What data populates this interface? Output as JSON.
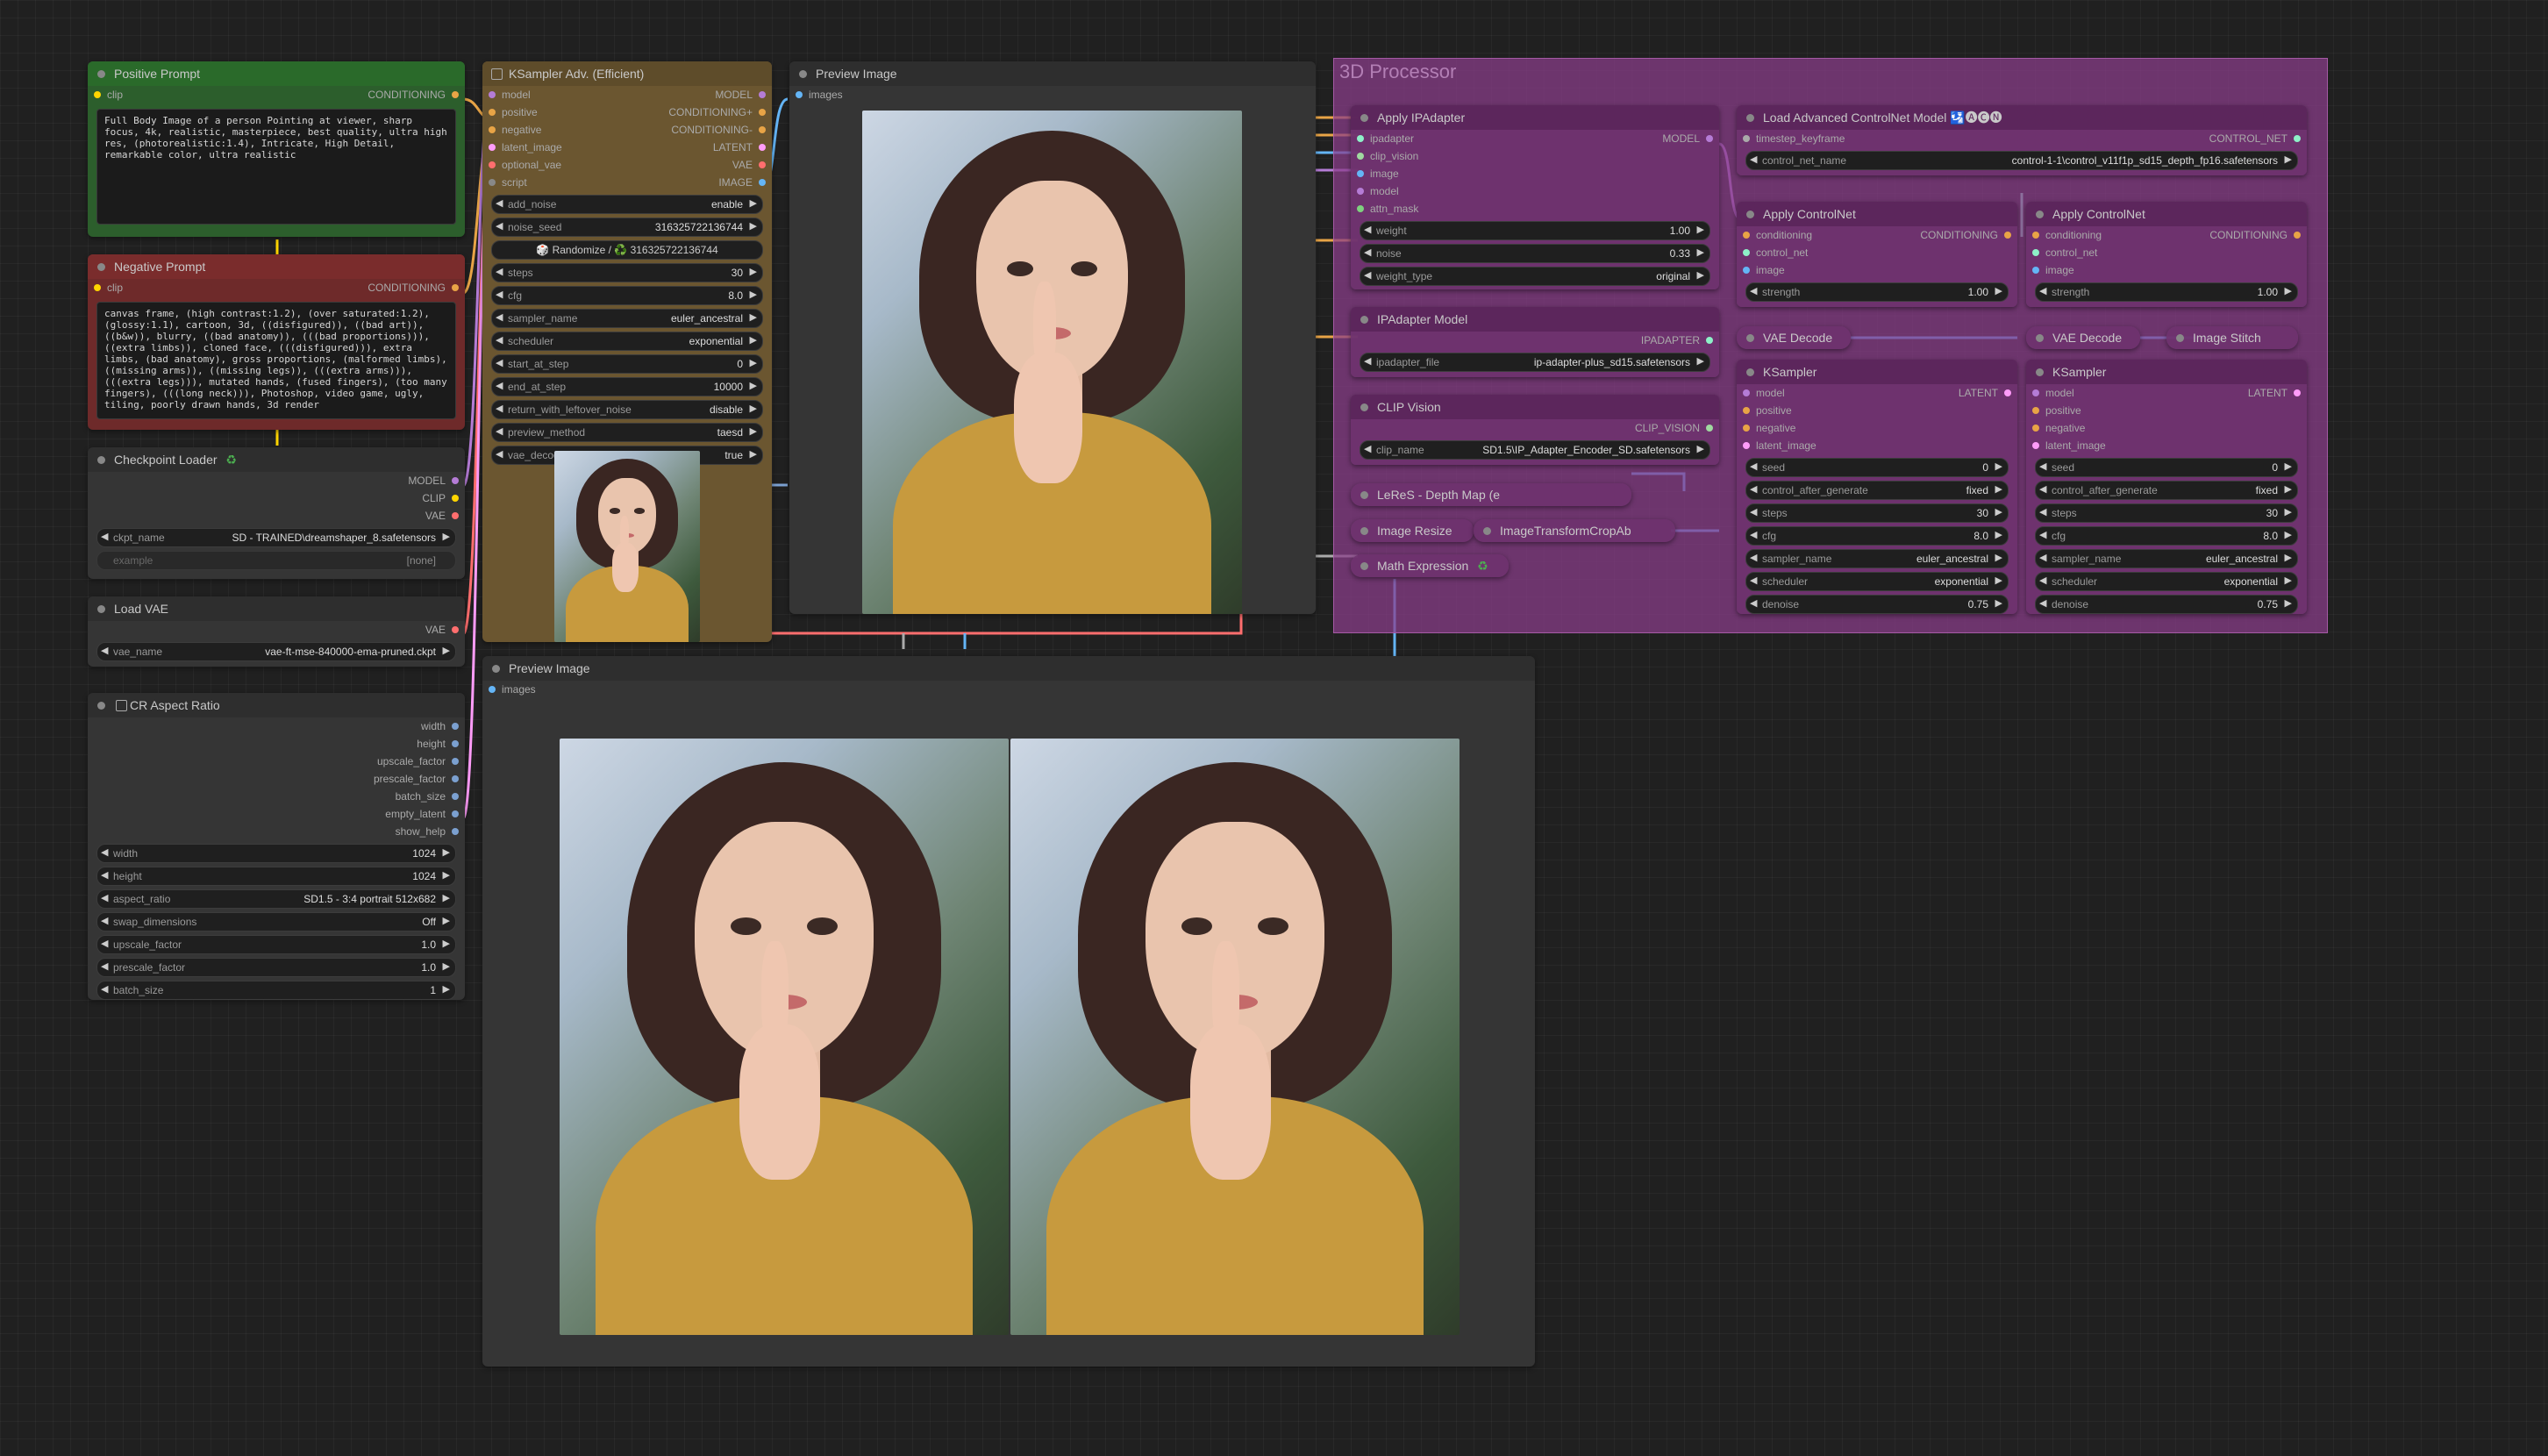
{
  "colors": {
    "group_3d_processor": "#8a3d8a",
    "positive_node": "#2c5e2c",
    "negative_node": "#6e2a2a",
    "ksampler_node": "#6b5630",
    "wire_model": "#b57cd6",
    "wire_conditioning": "#e8a446",
    "wire_latent": "#ff9cf9",
    "wire_image": "#64b5f6",
    "wire_vae": "#ff6e6e",
    "wire_clip": "#ffd500"
  },
  "positive_prompt": {
    "title": "Positive Prompt",
    "input_clip": "clip",
    "output": "CONDITIONING",
    "text": "Full Body Image of a person Pointing at viewer, sharp focus, 4k, realistic, masterpiece, best quality, ultra high res, (photorealistic:1.4), Intricate, High Detail, remarkable color, ultra realistic"
  },
  "negative_prompt": {
    "title": "Negative Prompt",
    "input_clip": "clip",
    "output": "CONDITIONING",
    "text": "canvas frame, (high contrast:1.2), (over saturated:1.2), (glossy:1.1), cartoon, 3d, ((disfigured)), ((bad art)), ((b&w)), blurry, ((bad anatomy)), (((bad proportions))), ((extra limbs)), cloned face, (((disfigured))), extra limbs, (bad anatomy), gross proportions, (malformed limbs), ((missing arms)), ((missing legs)), (((extra arms))), (((extra legs))), mutated hands, (fused fingers), (too many fingers), (((long neck))), Photoshop, video game, ugly, tiling, poorly drawn hands, 3d render"
  },
  "checkpoint_loader": {
    "title": "Checkpoint Loader",
    "outputs": [
      "MODEL",
      "CLIP",
      "VAE"
    ],
    "ckpt_label": "ckpt_name",
    "ckpt_value": "SD - TRAINED\\dreamshaper_8.safetensors",
    "example_label": "example",
    "example_value": "[none]"
  },
  "load_vae": {
    "title": "Load VAE",
    "output": "VAE",
    "vae_label": "vae_name",
    "vae_value": "vae-ft-mse-840000-ema-pruned.ckpt"
  },
  "cr_aspect_ratio": {
    "title": "CR Aspect Ratio",
    "outputs": [
      "width",
      "height",
      "upscale_factor",
      "prescale_factor",
      "batch_size",
      "empty_latent",
      "show_help"
    ],
    "widgets": [
      {
        "label": "width",
        "value": "1024"
      },
      {
        "label": "height",
        "value": "1024"
      },
      {
        "label": "aspect_ratio",
        "value": "SD1.5 - 3:4 portrait 512x682"
      },
      {
        "label": "swap_dimensions",
        "value": "Off"
      },
      {
        "label": "upscale_factor",
        "value": "1.0"
      },
      {
        "label": "prescale_factor",
        "value": "1.0"
      },
      {
        "label": "batch_size",
        "value": "1"
      }
    ]
  },
  "ksampler_adv": {
    "title": "KSampler Adv. (Efficient)",
    "inputs": [
      "model",
      "positive",
      "negative",
      "latent_image",
      "optional_vae",
      "script"
    ],
    "outputs": [
      "MODEL",
      "CONDITIONING+",
      "CONDITIONING-",
      "LATENT",
      "VAE",
      "IMAGE"
    ],
    "widgets": [
      {
        "label": "add_noise",
        "value": "enable"
      },
      {
        "label": "noise_seed",
        "value": "316325722136744"
      },
      {
        "label": "steps",
        "value": "30"
      },
      {
        "label": "cfg",
        "value": "8.0"
      },
      {
        "label": "sampler_name",
        "value": "euler_ancestral"
      },
      {
        "label": "scheduler",
        "value": "exponential"
      },
      {
        "label": "start_at_step",
        "value": "0"
      },
      {
        "label": "end_at_step",
        "value": "10000"
      },
      {
        "label": "return_with_leftover_noise",
        "value": "disable"
      },
      {
        "label": "preview_method",
        "value": "taesd"
      },
      {
        "label": "vae_decode",
        "value": "true"
      }
    ],
    "randomize_button": "🎲 Randomize / ♻️ 316325722136744"
  },
  "preview_image_top": {
    "title": "Preview Image",
    "input": "images"
  },
  "preview_image_bottom": {
    "title": "Preview Image",
    "input": "images"
  },
  "group_3d": {
    "title": "3D Processor",
    "apply_ipadapter": {
      "title": "Apply IPAdapter",
      "inputs": [
        "ipadapter",
        "clip_vision",
        "image",
        "model",
        "attn_mask"
      ],
      "output": "MODEL",
      "widgets": [
        {
          "label": "weight",
          "value": "1.00"
        },
        {
          "label": "noise",
          "value": "0.33"
        },
        {
          "label": "weight_type",
          "value": "original"
        }
      ]
    },
    "ipadapter_model": {
      "title": "IPAdapter Model",
      "output": "IPADAPTER",
      "widget": {
        "label": "ipadapter_file",
        "value": "ip-adapter-plus_sd15.safetensors"
      }
    },
    "clip_vision": {
      "title": "CLIP Vision",
      "output": "CLIP_VISION",
      "widget": {
        "label": "clip_name",
        "value": "SD1.5\\IP_Adapter_Encoder_SD.safetensors"
      }
    },
    "leres": {
      "title": "LeReS - Depth Map (e"
    },
    "image_resize": {
      "title": "Image Resize"
    },
    "image_transform": {
      "title": "ImageTransformCropAb"
    },
    "math_expression": {
      "title": "Math Expression"
    },
    "load_controlnet": {
      "title": "Load Advanced ControlNet Model 🛂🅐🅒🅝",
      "input": "timestep_keyframe",
      "output": "CONTROL_NET",
      "widget": {
        "label": "control_net_name",
        "value": "control-1-1\\control_v11f1p_sd15_depth_fp16.safetensors"
      }
    },
    "apply_controlnet_1": {
      "title": "Apply ControlNet",
      "inputs": [
        "conditioning",
        "control_net",
        "image"
      ],
      "output": "CONDITIONING",
      "widget": {
        "label": "strength",
        "value": "1.00"
      }
    },
    "apply_controlnet_2": {
      "title": "Apply ControlNet",
      "inputs": [
        "conditioning",
        "control_net",
        "image"
      ],
      "output": "CONDITIONING",
      "widget": {
        "label": "strength",
        "value": "1.00"
      }
    },
    "vae_decode_1": {
      "title": "VAE Decode"
    },
    "vae_decode_2": {
      "title": "VAE Decode"
    },
    "image_stitch": {
      "title": "Image Stitch"
    },
    "ksampler_1": {
      "title": "KSampler",
      "inputs": [
        "model",
        "positive",
        "negative",
        "latent_image"
      ],
      "output": "LATENT",
      "widgets": [
        {
          "label": "seed",
          "value": "0"
        },
        {
          "label": "control_after_generate",
          "value": "fixed"
        },
        {
          "label": "steps",
          "value": "30"
        },
        {
          "label": "cfg",
          "value": "8.0"
        },
        {
          "label": "sampler_name",
          "value": "euler_ancestral"
        },
        {
          "label": "scheduler",
          "value": "exponential"
        },
        {
          "label": "denoise",
          "value": "0.75"
        }
      ]
    },
    "ksampler_2": {
      "title": "KSampler",
      "inputs": [
        "model",
        "positive",
        "negative",
        "latent_image"
      ],
      "output": "LATENT",
      "widgets": [
        {
          "label": "seed",
          "value": "0"
        },
        {
          "label": "control_after_generate",
          "value": "fixed"
        },
        {
          "label": "steps",
          "value": "30"
        },
        {
          "label": "cfg",
          "value": "8.0"
        },
        {
          "label": "sampler_name",
          "value": "euler_ancestral"
        },
        {
          "label": "scheduler",
          "value": "exponential"
        },
        {
          "label": "denoise",
          "value": "0.75"
        }
      ]
    }
  }
}
